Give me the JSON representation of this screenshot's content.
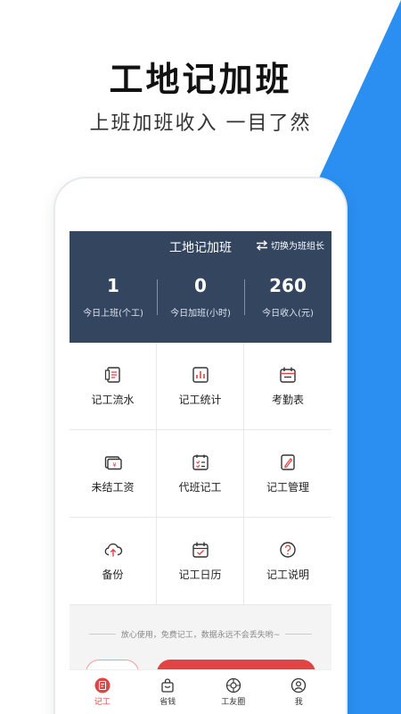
{
  "promo": {
    "title": "工地记加班",
    "subtitle": "上班加班收入  一目了然"
  },
  "header": {
    "title": "工地记加班",
    "switch_label": "切换为班组长"
  },
  "stats": [
    {
      "value": "1",
      "label": "今日上班(个工)"
    },
    {
      "value": "0",
      "label": "今日加班(小时)"
    },
    {
      "value": "260",
      "label": "今日收入(元)"
    }
  ],
  "grid": [
    {
      "label": "记工流水",
      "icon": "ledger-icon"
    },
    {
      "label": "记工统计",
      "icon": "statistics-icon"
    },
    {
      "label": "考勤表",
      "icon": "calendar-icon"
    },
    {
      "label": "未结工资",
      "icon": "wallet-icon"
    },
    {
      "label": "代班记工",
      "icon": "checklist-icon"
    },
    {
      "label": "记工管理",
      "icon": "edit-icon"
    },
    {
      "label": "备份",
      "icon": "cloud-upload-icon"
    },
    {
      "label": "记工日历",
      "icon": "calendar-check-icon"
    },
    {
      "label": "记工说明",
      "icon": "help-icon"
    }
  ],
  "note": "放心使用，免费记工，数据永远不会丢失哟~",
  "tabs": [
    {
      "label": "记工",
      "icon": "record-icon",
      "active": true
    },
    {
      "label": "省钱",
      "icon": "bag-icon",
      "active": false
    },
    {
      "label": "工友圈",
      "icon": "community-icon",
      "active": false
    },
    {
      "label": "我",
      "icon": "user-icon",
      "active": false
    }
  ],
  "colors": {
    "accent_blue": "#2a8ff0",
    "header_bg": "#33455f",
    "accent_red": "#e04444"
  }
}
